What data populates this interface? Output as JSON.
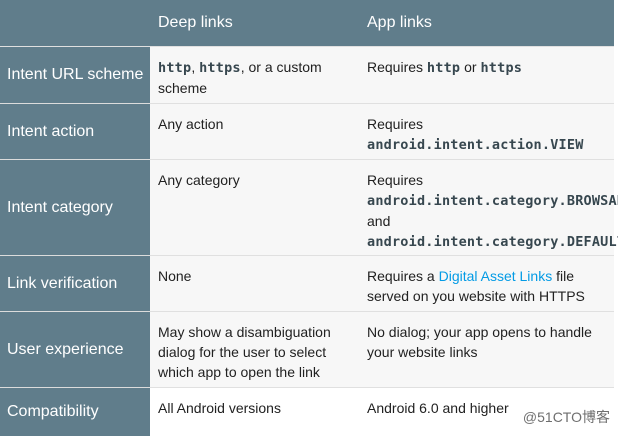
{
  "header": {
    "corner": "",
    "deep_links": "Deep links",
    "app_links": "App links"
  },
  "rows": [
    {
      "label": "Intent URL scheme",
      "deep": {
        "code1": "http",
        "sep1": ", ",
        "code2": "https",
        "rest": ", or a custom scheme"
      },
      "app": {
        "pre": "Requires ",
        "code1": "http",
        "mid": " or ",
        "code2": "https"
      }
    },
    {
      "label": "Intent action",
      "deep": {
        "text": "Any action"
      },
      "app": {
        "pre": "Requires ",
        "code": "android.intent.action.VIEW"
      }
    },
    {
      "label": "Intent category",
      "deep": {
        "text": "Any category"
      },
      "app": {
        "pre": "Requires ",
        "code1": "android.intent.category.BROWSABLE",
        "mid": " and ",
        "code2": "android.intent.category.DEFAULT"
      }
    },
    {
      "label": "Link verification",
      "deep": {
        "text": "None"
      },
      "app": {
        "pre": "Requires a ",
        "link": "Digital Asset Links",
        "post": " file served on you website with HTTPS"
      }
    },
    {
      "label": "User experience",
      "deep": {
        "text": "May show a disambiguation dialog for the user to select which app to open the link"
      },
      "app": {
        "text": "No dialog; your app opens to handle your website links"
      }
    },
    {
      "label": "Compatibility",
      "deep": {
        "text": "All Android versions"
      },
      "app": {
        "text": "Android 6.0 and higher"
      }
    }
  ],
  "watermark": "@51CTO博客",
  "colors": {
    "header_bg": "#607d8b",
    "cell_bg": "#f7f7f7",
    "link": "#039be5",
    "code": "#37474f"
  }
}
